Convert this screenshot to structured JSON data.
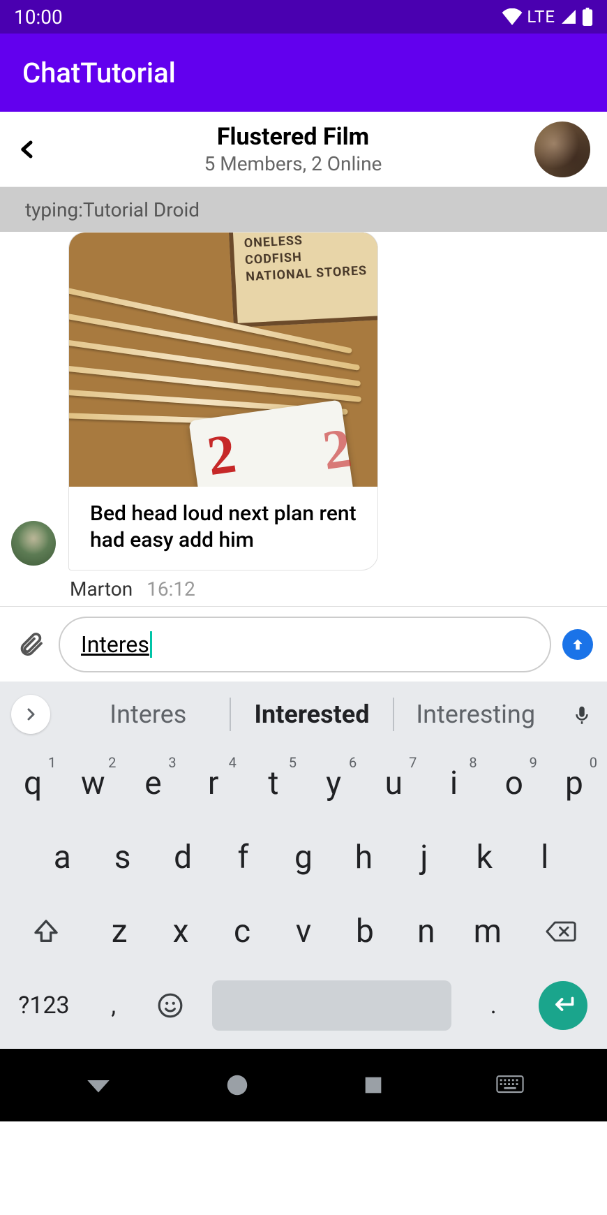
{
  "status": {
    "time": "10:00",
    "network": "LTE"
  },
  "app": {
    "title": "ChatTutorial"
  },
  "chat": {
    "title": "Flustered Film",
    "subtitle": "5 Members, 2 Online",
    "typing_prefix": "typing: ",
    "typing_user": "Tutorial Droid"
  },
  "message": {
    "image_board_lines": [
      "ONELESS",
      "CODFISH",
      "NATIONAL STORES"
    ],
    "text": "Bed head loud next plan rent had easy add him",
    "sender": "Marton",
    "time": "16:12"
  },
  "composer": {
    "value": "Interes"
  },
  "suggestions": [
    "Interes",
    "Interested",
    "Interesting"
  ],
  "keyboard": {
    "row1": [
      {
        "k": "q",
        "n": "1"
      },
      {
        "k": "w",
        "n": "2"
      },
      {
        "k": "e",
        "n": "3"
      },
      {
        "k": "r",
        "n": "4"
      },
      {
        "k": "t",
        "n": "5"
      },
      {
        "k": "y",
        "n": "6"
      },
      {
        "k": "u",
        "n": "7"
      },
      {
        "k": "i",
        "n": "8"
      },
      {
        "k": "o",
        "n": "9"
      },
      {
        "k": "p",
        "n": "0"
      }
    ],
    "row2": [
      "a",
      "s",
      "d",
      "f",
      "g",
      "h",
      "j",
      "k",
      "l"
    ],
    "row3": [
      "z",
      "x",
      "c",
      "v",
      "b",
      "n",
      "m"
    ],
    "symbols": "?123",
    "comma": ",",
    "period": "."
  }
}
